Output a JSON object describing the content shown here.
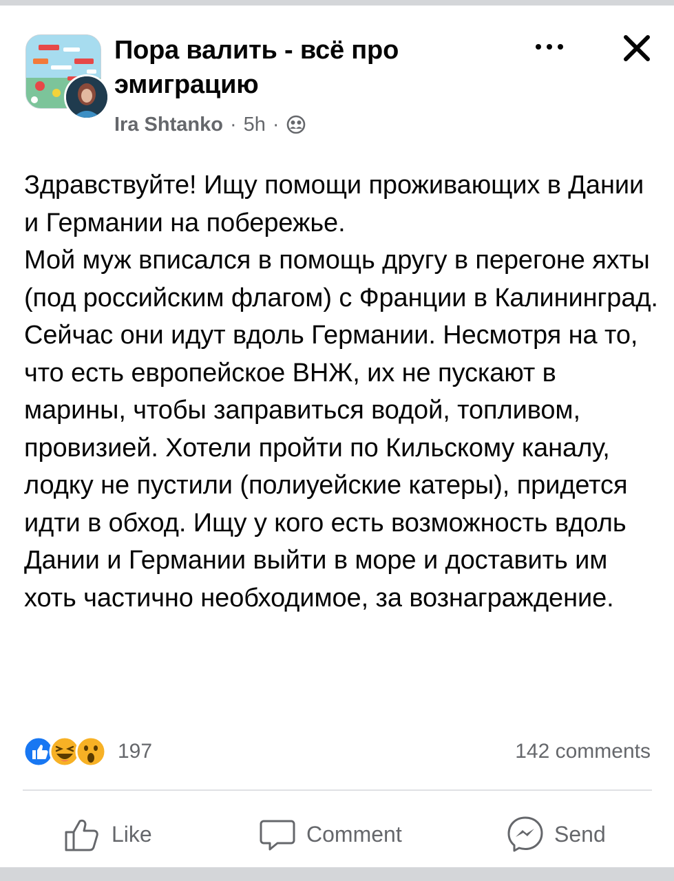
{
  "header": {
    "group_title": "Пора валить - всё про эмиграцию",
    "author": "Ira Shtanko",
    "time": "5h",
    "separator": "·",
    "privacy_icon": "group-members-icon",
    "more_icon": "more-dots-icon",
    "close_icon": "close-icon"
  },
  "post": {
    "text": "Здравствуйте! Ищу помощи проживающих в Дании и Германии на побережье.\nМой муж вписался в помощь другу в перегоне яхты (под российским флагом) с Франции в Калининград. Сейчас они идут вдоль Германии. Несмотря на то, что есть европейское ВНЖ, их не пускают в марины, чтобы заправиться водой, топливом, провизией. Хотели пройти по  Кильскому каналу, лодку не пустили (полиуейские катеры), придется идти в обход. Ищу у кого есть возможность вдоль Дании и Германии выйти в море и доставить им хоть частично необходимое, за вознаграждение."
  },
  "reactions": {
    "icons": [
      "like-icon",
      "haha-icon",
      "wow-icon"
    ],
    "count": "197",
    "comments": "142 comments"
  },
  "actions": {
    "like": "Like",
    "comment": "Comment",
    "send": "Send"
  },
  "colors": {
    "text": "#050505",
    "secondary": "#65676b",
    "like_blue": "#1877f2",
    "reaction_yellow": "#f7b125",
    "divider": "#dfe1e4"
  }
}
